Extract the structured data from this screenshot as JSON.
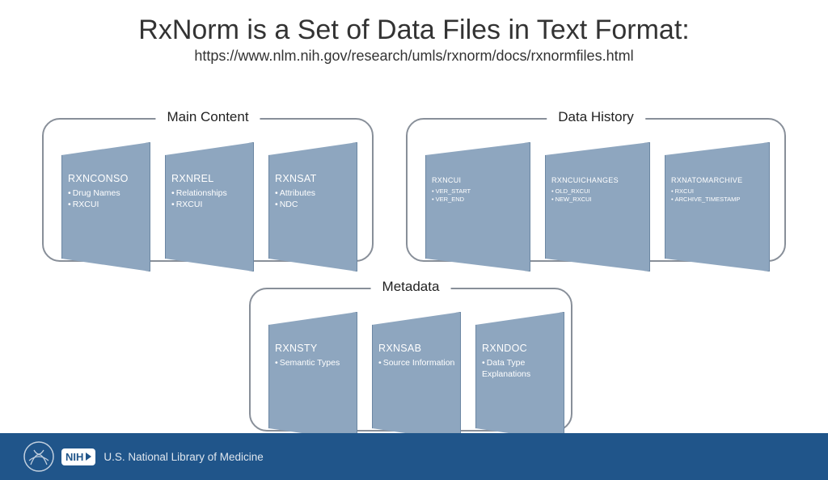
{
  "title": "RxNorm is a Set of Data Files in Text Format:",
  "subtitle": "https://www.nlm.nih.gov/research/umls/rxnorm/docs/rxnormfiles.html",
  "groups": {
    "main": {
      "label": "Main Content",
      "cards": [
        {
          "title": "RXNCONSO",
          "items": [
            "Drug Names",
            "RXCUI"
          ]
        },
        {
          "title": "RXNREL",
          "items": [
            "Relationships",
            "RXCUI"
          ]
        },
        {
          "title": "RXNSAT",
          "items": [
            "Attributes",
            "NDC"
          ]
        }
      ]
    },
    "history": {
      "label": "Data History",
      "cards": [
        {
          "title": "RXNCUI",
          "items": [
            "VER_START",
            "VER_END"
          ]
        },
        {
          "title": "RXNCUICHANGES",
          "items": [
            "OLD_RXCUI",
            "NEW_RXCUI"
          ]
        },
        {
          "title": "RXNATOMARCHIVE",
          "items": [
            "RXCUI",
            "ARCHIVE_TIMESTAMP"
          ]
        }
      ]
    },
    "meta": {
      "label": "Metadata",
      "cards": [
        {
          "title": "RXNSTY",
          "items": [
            "Semantic Types"
          ]
        },
        {
          "title": "RXNSAB",
          "items": [
            "Source Information"
          ]
        },
        {
          "title": "RXNDOC",
          "items": [
            "Data Type Explanations"
          ]
        }
      ]
    }
  },
  "footer": {
    "nih_label": "NIH",
    "org": "U.S. National Library of Medicine"
  }
}
